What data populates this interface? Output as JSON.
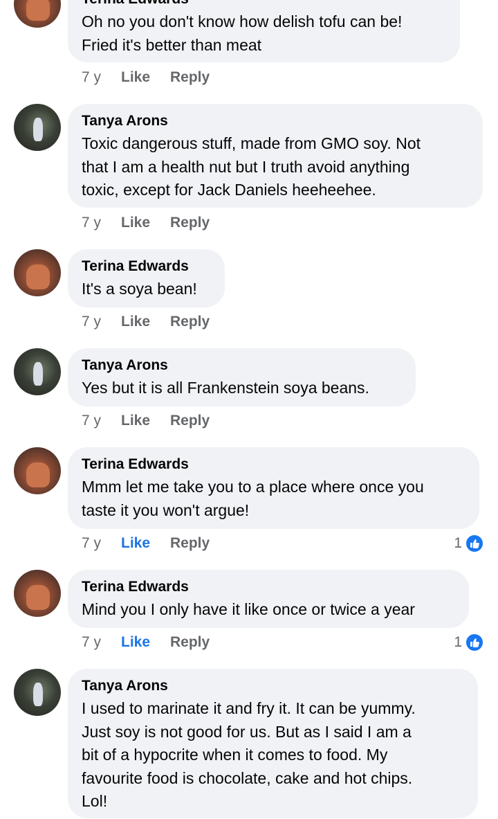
{
  "comments": [
    {
      "name": "Terina Edwards",
      "text": "Oh no you don't know how delish tofu can be!\nFried it's better than meat",
      "time": "7 y",
      "like_label": "Like",
      "reply_label": "Reply",
      "reaction_count": ""
    },
    {
      "name": "Tanya Arons",
      "text": "Toxic dangerous stuff, made from GMO soy.  Not\nthat I am a health nut but I truth avoid anything\ntoxic, except for Jack Daniels heeheehee.",
      "time": "7 y",
      "like_label": "Like",
      "reply_label": "Reply",
      "reaction_count": ""
    },
    {
      "name": "Terina Edwards",
      "text": "It's a soya bean!",
      "time": "7 y",
      "like_label": "Like",
      "reply_label": "Reply",
      "reaction_count": ""
    },
    {
      "name": "Tanya Arons",
      "text": "Yes but it is all Frankenstein soya beans.",
      "time": "7 y",
      "like_label": "Like",
      "reply_label": "Reply",
      "reaction_count": ""
    },
    {
      "name": "Terina Edwards",
      "text": "Mmm let me take you to a place where once you\ntaste it you won't argue!",
      "time": "7 y",
      "like_label": "Like",
      "reply_label": "Reply",
      "reaction_count": "1"
    },
    {
      "name": "Terina Edwards",
      "text": "Mind you I only have it like once or twice a year",
      "time": "7 y",
      "like_label": "Like",
      "reply_label": "Reply",
      "reaction_count": "1"
    },
    {
      "name": "Tanya Arons",
      "text": "I used to marinate it and fry it.  It can be yummy.\nJust soy is not good for us.   But as I said I am a\nbit of a hypocrite when it comes to food.  My\nfavourite food is chocolate, cake and hot chips.\nLol!",
      "time": "",
      "like_label": "",
      "reply_label": "",
      "reaction_count": ""
    }
  ],
  "colors": {
    "like_active": "#1b74e4",
    "bubble": "#f0f2f5",
    "meta": "#65676b",
    "reaction": "#1877f2"
  },
  "icons": {
    "reaction": "thumbs-up-icon"
  }
}
